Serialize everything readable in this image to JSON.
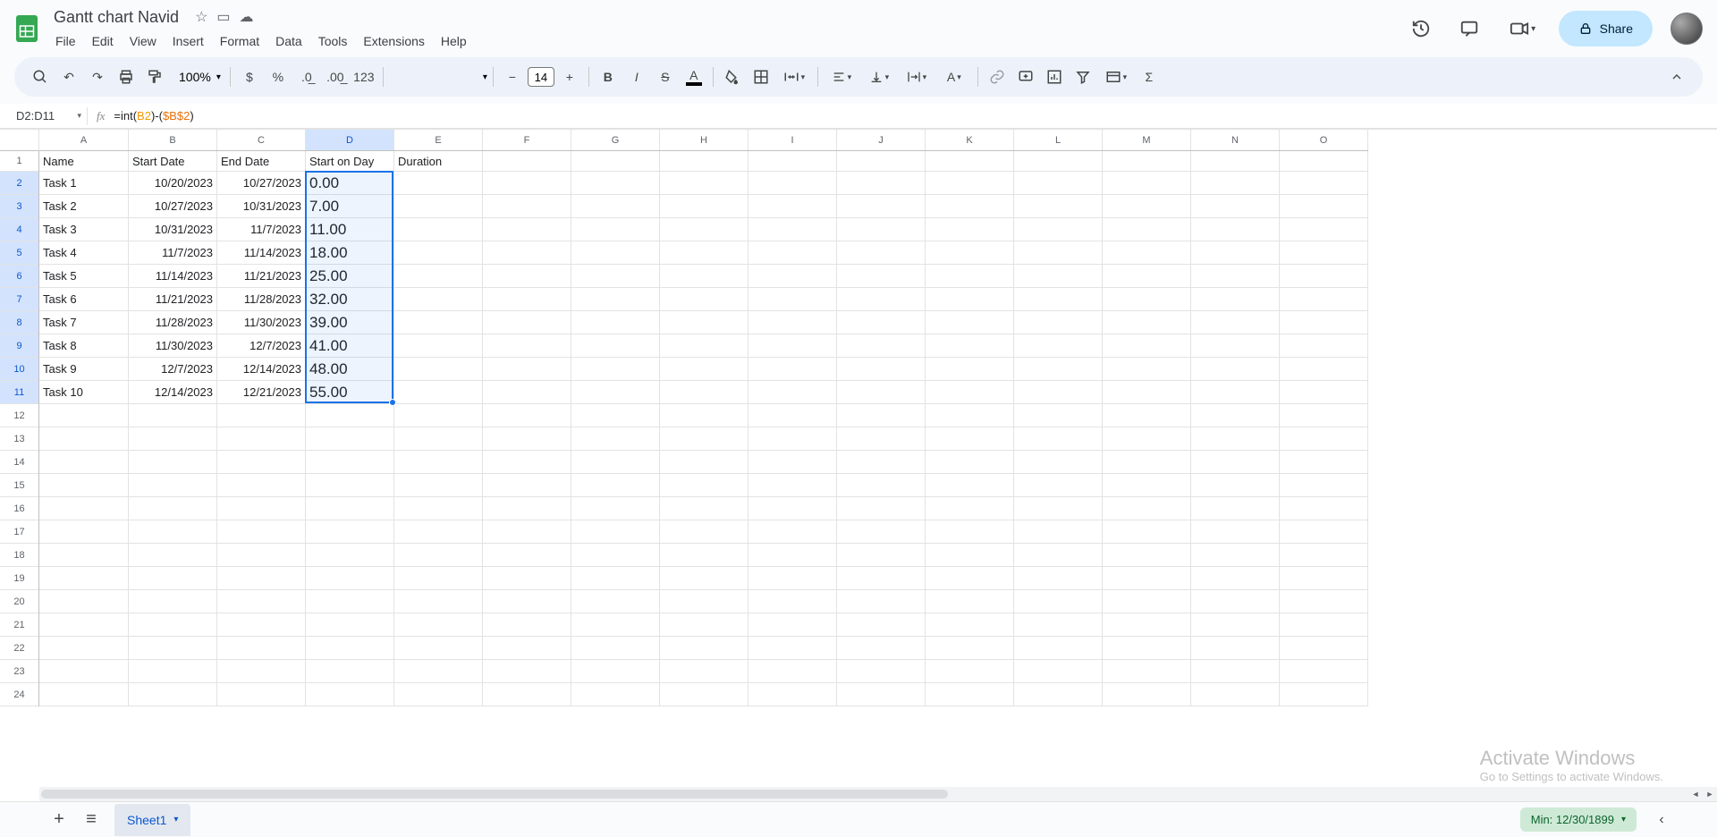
{
  "doc": {
    "title": "Gantt chart Navid"
  },
  "menus": [
    "File",
    "Edit",
    "View",
    "Insert",
    "Format",
    "Data",
    "Tools",
    "Extensions",
    "Help"
  ],
  "header": {
    "share": "Share"
  },
  "toolbar": {
    "zoom": "100%",
    "num_format": "123",
    "font_size": "14"
  },
  "namebox": "D2:D11",
  "formula": {
    "plain": "=int(B2)-($B$2)",
    "prefix": "=int(",
    "rel": "B2",
    "mid": ")-(",
    "abs": "$B$2",
    "suffix": ")"
  },
  "columns": [
    "A",
    "B",
    "C",
    "D",
    "E",
    "F",
    "G",
    "H",
    "I",
    "J",
    "K",
    "L",
    "M",
    "N",
    "O"
  ],
  "headers": {
    "A": "Name",
    "B": "Start Date",
    "C": "End Date",
    "D": "Start on Day",
    "E": "Duration"
  },
  "rows": [
    {
      "name": "Task 1",
      "start": "10/20/2023",
      "end": "10/27/2023",
      "day": "0.00"
    },
    {
      "name": "Task 2",
      "start": "10/27/2023",
      "end": "10/31/2023",
      "day": "7.00"
    },
    {
      "name": "Task 3",
      "start": "10/31/2023",
      "end": "11/7/2023",
      "day": "11.00"
    },
    {
      "name": "Task 4",
      "start": "11/7/2023",
      "end": "11/14/2023",
      "day": "18.00"
    },
    {
      "name": "Task 5",
      "start": "11/14/2023",
      "end": "11/21/2023",
      "day": "25.00"
    },
    {
      "name": "Task 6",
      "start": "11/21/2023",
      "end": "11/28/2023",
      "day": "32.00"
    },
    {
      "name": "Task 7",
      "start": "11/28/2023",
      "end": "11/30/2023",
      "day": "39.00"
    },
    {
      "name": "Task 8",
      "start": "11/30/2023",
      "end": "12/7/2023",
      "day": "41.00"
    },
    {
      "name": "Task 9",
      "start": "12/7/2023",
      "end": "12/14/2023",
      "day": "48.00"
    },
    {
      "name": "Task 10",
      "start": "12/14/2023",
      "end": "12/21/2023",
      "day": "55.00"
    }
  ],
  "footer": {
    "sheet": "Sheet1",
    "status": "Min: 12/30/1899"
  },
  "watermark": {
    "t1": "Activate Windows",
    "t2": "Go to Settings to activate Windows."
  },
  "selected_col_index": 3,
  "colors": {
    "accent": "#1a73e8"
  }
}
